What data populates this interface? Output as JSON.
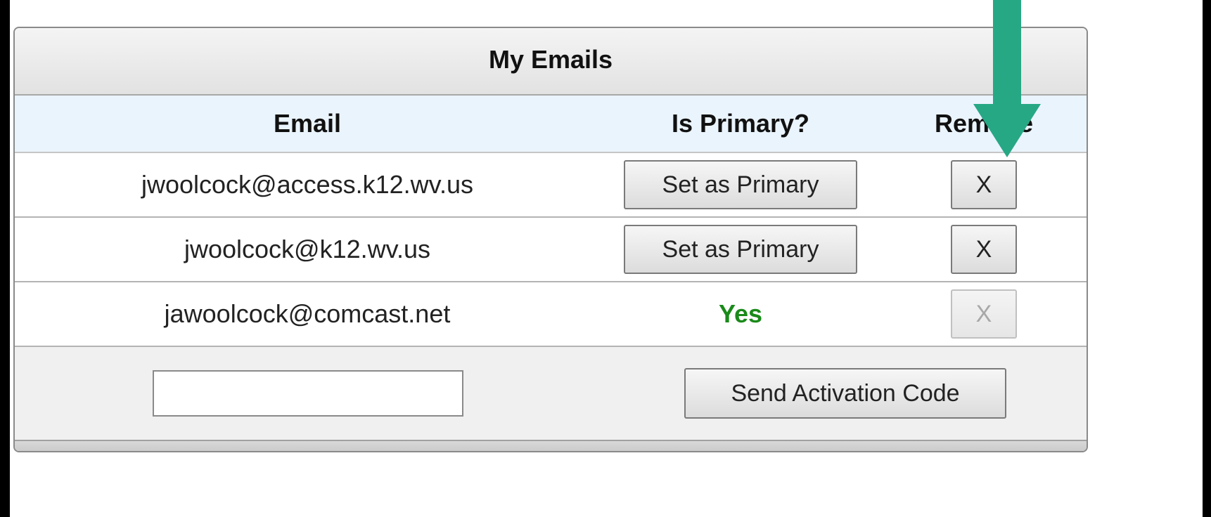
{
  "panel": {
    "title": "My Emails"
  },
  "table": {
    "headers": {
      "email": "Email",
      "primary": "Is Primary?",
      "remove": "Remove"
    },
    "rows": [
      {
        "email": "jwoolcock@access.k12.wv.us",
        "action_label": "Set as Primary",
        "remove_label": "X",
        "is_primary": false
      },
      {
        "email": "jwoolcock@k12.wv.us",
        "action_label": "Set as Primary",
        "remove_label": "X",
        "is_primary": false
      },
      {
        "email": "jawoolcock@comcast.net",
        "primary_text": "Yes",
        "remove_label": "X",
        "is_primary": true
      }
    ]
  },
  "footer": {
    "new_email_value": "",
    "send_label": "Send Activation Code"
  },
  "colors": {
    "annotation_arrow": "#26a884",
    "primary_yes": "#1a8a1a",
    "header_row_bg": "#eaf4fd"
  },
  "icons": {
    "annotation": "down-arrow-icon"
  }
}
